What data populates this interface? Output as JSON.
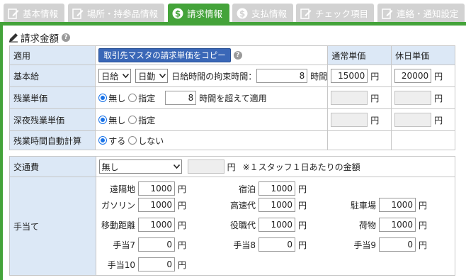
{
  "tabs": [
    {
      "label": "基本情報",
      "icon": "edit-icon",
      "active": false
    },
    {
      "label": "場所・持参品情報",
      "icon": "edit-icon",
      "active": false
    },
    {
      "label": "請求情報",
      "icon": "dollar-icon",
      "active": true
    },
    {
      "label": "支払情報",
      "icon": "dollar-icon",
      "active": false
    },
    {
      "label": "チェック項目",
      "icon": "edit-icon",
      "active": false
    },
    {
      "label": "連絡・通知設定",
      "icon": "edit-icon",
      "active": false
    }
  ],
  "section": {
    "title": "請求金額",
    "help": "?"
  },
  "billing": {
    "header": {
      "apply": "適用",
      "copy_button": "取引先マスタの請求単価をコピー",
      "normal_rate": "通常単価",
      "holiday_rate": "休日単価"
    },
    "base": {
      "label": "基本給",
      "pay_type": "日給",
      "unit_type": "日勤",
      "bind_label": "日給時間の拘束時間：",
      "bind_hours": "8",
      "hours_unit": "時間",
      "normal": "15000",
      "holiday": "20000",
      "yen": "円"
    },
    "overtime": {
      "label": "残業単価",
      "opt_none": "無し",
      "opt_specify": "指定",
      "hours": "8",
      "after_text": "時間を超えて適用",
      "yen": "円"
    },
    "night": {
      "label": "深夜残業単価",
      "opt_none": "無し",
      "opt_specify": "指定",
      "yen": "円"
    },
    "auto": {
      "label": "残業時間自動計算",
      "opt_yes": "する",
      "opt_no": "しない"
    }
  },
  "transport": {
    "label": "交通費",
    "select_value": "無し",
    "yen": "円",
    "note": "※１スタッフ１日あたりの金額"
  },
  "allowance": {
    "label": "手当て",
    "yen": "円",
    "items": [
      {
        "label": "遠隔地",
        "value": "1000"
      },
      {
        "label": "宿泊",
        "value": "1000"
      },
      {
        "label": "ガソリン",
        "value": "1000"
      },
      {
        "label": "高速代",
        "value": "1000"
      },
      {
        "label": "駐車場",
        "value": "1000"
      },
      {
        "label": "移動距離",
        "value": "1000"
      },
      {
        "label": "役職代",
        "value": "1000"
      },
      {
        "label": "荷物",
        "value": "1000"
      },
      {
        "label": "手当7",
        "value": "0"
      },
      {
        "label": "手当8",
        "value": "0"
      },
      {
        "label": "手当9",
        "value": "0"
      },
      {
        "label": "手当10",
        "value": "0"
      }
    ]
  },
  "colors": {
    "accent": "#44a33a",
    "label_bg": "#dce8f6",
    "button": "#3a67b7",
    "tab_inactive": "#d2d2d2"
  }
}
